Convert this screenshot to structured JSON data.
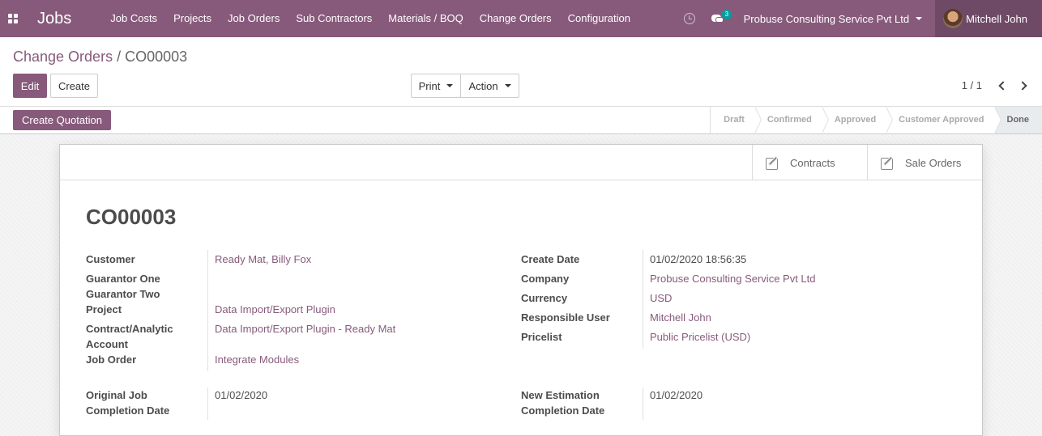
{
  "navbar": {
    "brand": "Jobs",
    "menu": [
      "Job Costs",
      "Projects",
      "Job Orders",
      "Sub Contractors",
      "Materials / BOQ",
      "Change Orders",
      "Configuration"
    ],
    "messages_badge": "3",
    "company": "Probuse Consulting Service Pvt Ltd",
    "user": "Mitchell John",
    "accent_color": "#875a7b"
  },
  "breadcrumb": {
    "parent": "Change Orders",
    "separator": "/",
    "current": "CO00003"
  },
  "toolbar": {
    "edit_label": "Edit",
    "create_label": "Create",
    "print_label": "Print",
    "action_label": "Action"
  },
  "pager": {
    "value": "1 / 1"
  },
  "statusbar": {
    "quote_button": "Create Quotation",
    "stages": [
      "Draft",
      "Confirmed",
      "Approved",
      "Customer Approved",
      "Done"
    ],
    "active_stage": "Done"
  },
  "smart_buttons": {
    "contracts": "Contracts",
    "sale_orders": "Sale Orders"
  },
  "record": {
    "name": "CO00003",
    "left_fields": {
      "customer": {
        "label": "Customer",
        "value": "Ready Mat, Billy Fox"
      },
      "guarantor_one": {
        "label": "Guarantor One",
        "value": ""
      },
      "guarantor_two": {
        "label": "Guarantor Two",
        "value": ""
      },
      "project": {
        "label": "Project",
        "value": "Data Import/Export Plugin"
      },
      "contract_line1": "Contract/Analytic",
      "contract_line2": "Account",
      "contract_value": "Data Import/Export Plugin - Ready Mat",
      "job_order": {
        "label": "Job Order",
        "value": "Integrate Modules"
      },
      "orig_line1": "Original Job",
      "orig_line2": "Completion Date",
      "orig_value": "01/02/2020"
    },
    "right_fields": {
      "create_date": {
        "label": "Create Date",
        "value": "01/02/2020 18:56:35"
      },
      "company": {
        "label": "Company",
        "value": "Probuse Consulting Service Pvt Ltd"
      },
      "currency": {
        "label": "Currency",
        "value": "USD"
      },
      "responsible": {
        "label": "Responsible User",
        "value": "Mitchell John"
      },
      "pricelist": {
        "label": "Pricelist",
        "value": "Public Pricelist (USD)"
      },
      "newest_line1": "New Estimation",
      "newest_line2": "Completion Date",
      "newest_value": "01/02/2020"
    }
  }
}
